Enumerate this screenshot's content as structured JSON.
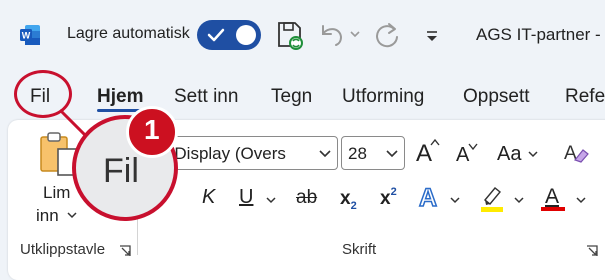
{
  "title_bar": {
    "app_icon": "word-logo-icon",
    "autosave_label": "Lagre automatisk",
    "autosave_on": true,
    "doc_title": "AGS IT-partner -"
  },
  "tabs": [
    {
      "label": "Fil",
      "active": false
    },
    {
      "label": "Hjem",
      "active": true
    },
    {
      "label": "Sett inn",
      "active": false
    },
    {
      "label": "Tegn",
      "active": false
    },
    {
      "label": "Utforming",
      "active": false
    },
    {
      "label": "Oppsett",
      "active": false
    },
    {
      "label": "Refer",
      "active": false
    }
  ],
  "ribbon": {
    "clipboard": {
      "paste_line1": "Lim",
      "paste_line2": "inn",
      "group_label": "Utklippstavle"
    },
    "font": {
      "font_name": "tos Display (Overs",
      "font_size": "28",
      "grow_label": "A",
      "shrink_label": "A",
      "case_label": "Aa",
      "italic": "K",
      "underline": "U",
      "strike": "ab",
      "subscript": "x",
      "subscript_mark": "2",
      "superscript": "x",
      "superscript_mark": "2",
      "effects": "A",
      "font_color": "A",
      "group_label": "Skrift"
    }
  },
  "callout": {
    "big_label": "Fil",
    "badge": "1",
    "color": "#c8102e"
  },
  "colors": {
    "accent": "#1f4fa3",
    "highlight": "#ffeb00",
    "font_color": "#e00000"
  }
}
